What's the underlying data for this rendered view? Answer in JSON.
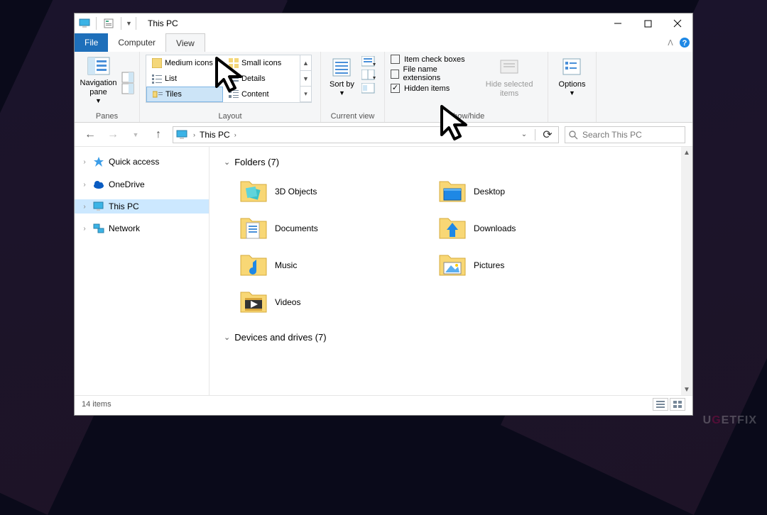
{
  "window": {
    "title": "This PC"
  },
  "tabs": {
    "file": "File",
    "computer": "Computer",
    "view": "View"
  },
  "ribbon": {
    "panes": {
      "nav_pane": "Navigation pane",
      "label": "Panes"
    },
    "layout": {
      "items": [
        "Medium icons",
        "Small icons",
        "List",
        "Details",
        "Tiles",
        "Content"
      ],
      "label": "Layout"
    },
    "current_view": {
      "sort_by": "Sort by",
      "label": "Current view"
    },
    "show_hide": {
      "item_check_boxes": "Item check boxes",
      "file_name_extensions": "File name extensions",
      "hidden_items": "Hidden items",
      "hide_selected": "Hide selected items",
      "label": "Show/hide"
    },
    "options": "Options"
  },
  "navbar": {
    "crumb": "This PC",
    "search_placeholder": "Search This PC"
  },
  "sidebar": {
    "quick_access": "Quick access",
    "onedrive": "OneDrive",
    "this_pc": "This PC",
    "network": "Network"
  },
  "content": {
    "folders_header": "Folders (7)",
    "devices_header": "Devices and drives (7)",
    "items": [
      {
        "name": "3D Objects",
        "icon": "3d"
      },
      {
        "name": "Desktop",
        "icon": "desktop"
      },
      {
        "name": "Documents",
        "icon": "documents"
      },
      {
        "name": "Downloads",
        "icon": "downloads"
      },
      {
        "name": "Music",
        "icon": "music"
      },
      {
        "name": "Pictures",
        "icon": "pictures"
      },
      {
        "name": "Videos",
        "icon": "videos"
      }
    ]
  },
  "status": {
    "items": "14 items"
  },
  "watermark": "UGETFIX"
}
